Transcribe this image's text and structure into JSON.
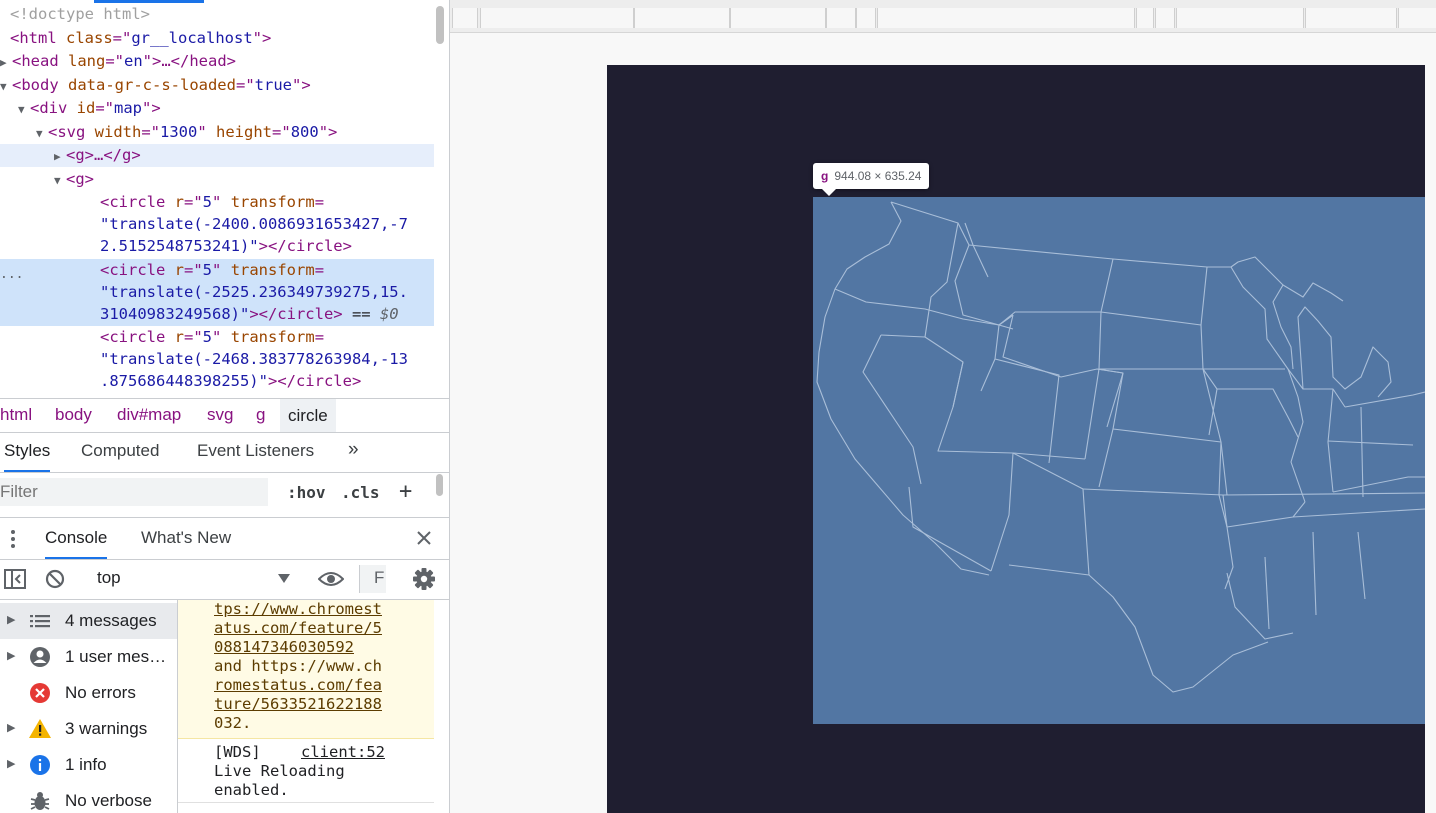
{
  "elements": {
    "lines": [
      {
        "segs": [
          [
            "g",
            "<!doctype html>"
          ]
        ]
      },
      {
        "segs": [
          [
            "t",
            "<html "
          ],
          [
            "a",
            "class"
          ],
          [
            "t",
            "=\""
          ],
          [
            "v",
            "gr__localhost"
          ],
          [
            "t",
            "\">"
          ]
        ]
      },
      {
        "segs": [
          [
            "t",
            "<head "
          ],
          [
            "a",
            "lang"
          ],
          [
            "t",
            "=\""
          ],
          [
            "v",
            "en"
          ],
          [
            "t",
            "\">…</head>"
          ]
        ]
      },
      {
        "segs": [
          [
            "t",
            "<body "
          ],
          [
            "a",
            "data-gr-c-s-loaded"
          ],
          [
            "t",
            "=\""
          ],
          [
            "v",
            "true"
          ],
          [
            "t",
            "\">"
          ]
        ]
      },
      {
        "segs": [
          [
            "t",
            "<div "
          ],
          [
            "a",
            "id"
          ],
          [
            "t",
            "=\""
          ],
          [
            "v",
            "map"
          ],
          [
            "t",
            "\">"
          ]
        ]
      },
      {
        "segs": [
          [
            "t",
            "<svg "
          ],
          [
            "a",
            "width"
          ],
          [
            "t",
            "=\""
          ],
          [
            "v",
            "1300"
          ],
          [
            "t",
            "\" "
          ],
          [
            "a",
            "height"
          ],
          [
            "t",
            "=\""
          ],
          [
            "v",
            "800"
          ],
          [
            "t",
            "\">"
          ]
        ]
      },
      {
        "segs": [
          [
            "t",
            "<g>…</g>"
          ]
        ]
      },
      {
        "segs": [
          [
            "t",
            "<g>"
          ]
        ]
      },
      {
        "segs": [
          [
            "t",
            "<circle "
          ],
          [
            "a",
            "r"
          ],
          [
            "t",
            "=\""
          ],
          [
            "v",
            "5"
          ],
          [
            "t",
            "\" "
          ],
          [
            "a",
            "transform"
          ],
          [
            "t",
            "="
          ]
        ]
      },
      {
        "segs": [
          [
            "v",
            "\"translate(-2400.0086931653427,-7"
          ]
        ]
      },
      {
        "segs": [
          [
            "v",
            "2.5152548753241)\""
          ],
          [
            "t",
            "></circle>"
          ]
        ]
      },
      {
        "segs": [
          [
            "t",
            "<circle "
          ],
          [
            "a",
            "r"
          ],
          [
            "t",
            "=\""
          ],
          [
            "v",
            "5"
          ],
          [
            "t",
            "\" "
          ],
          [
            "a",
            "transform"
          ],
          [
            "t",
            "="
          ]
        ]
      },
      {
        "segs": [
          [
            "v",
            "\"translate(-2525.236349739275,15."
          ]
        ]
      },
      {
        "segs": [
          [
            "v",
            "31040983249568)\""
          ],
          [
            "t",
            "></circle>"
          ],
          [
            "plain",
            " == "
          ],
          [
            "it",
            "$0"
          ]
        ]
      },
      {
        "segs": [
          [
            "t",
            "<circle "
          ],
          [
            "a",
            "r"
          ],
          [
            "t",
            "=\""
          ],
          [
            "v",
            "5"
          ],
          [
            "t",
            "\" "
          ],
          [
            "a",
            "transform"
          ],
          [
            "t",
            "="
          ]
        ]
      },
      {
        "segs": [
          [
            "v",
            "\"translate(-2468.383778263984,-13"
          ]
        ]
      },
      {
        "segs": [
          [
            "v",
            ".875686448398255)\""
          ],
          [
            "t",
            "></circle>"
          ]
        ]
      }
    ],
    "selected_marker": "..."
  },
  "breadcrumbs": [
    "html",
    "body",
    "div#map",
    "svg",
    "g",
    "circle"
  ],
  "styles_tabs": {
    "styles": "Styles",
    "computed": "Computed",
    "event_listeners": "Event Listeners",
    "more": "»"
  },
  "filter": {
    "placeholder": "Filter",
    "hov": ":hov",
    "cls": ".cls",
    "add": "+"
  },
  "console": {
    "tabs": {
      "console": "Console",
      "whats_new": "What's New"
    },
    "context": "top",
    "filter_initial": "F",
    "sidebar": [
      {
        "label": "4 messages",
        "icon": "list-icon"
      },
      {
        "label": "1 user mes…",
        "icon": "user-icon"
      },
      {
        "label": "No errors",
        "icon": "error-icon"
      },
      {
        "label": "3 warnings",
        "icon": "warning-icon"
      },
      {
        "label": "1 info",
        "icon": "info-icon"
      },
      {
        "label": "No verbose",
        "icon": "bug-icon"
      }
    ],
    "warning_lines": [
      "tps://www.chromest",
      "atus.com/feature/5",
      "088147346030592",
      "and https://www.ch",
      "romestatus.com/fea",
      "ture/5633521622188",
      "032."
    ],
    "wds": {
      "prefix": "[WDS]",
      "source": "client:52",
      "line2": "Live Reloading",
      "line3": "enabled."
    }
  },
  "viewport": {
    "tooltip": {
      "tag": "g",
      "dims": "944.08 × 635.24"
    },
    "colors": {
      "page_bg": "#1f1e30",
      "map_fill": "#5276a3",
      "state_stroke": "#a9bed8"
    }
  }
}
